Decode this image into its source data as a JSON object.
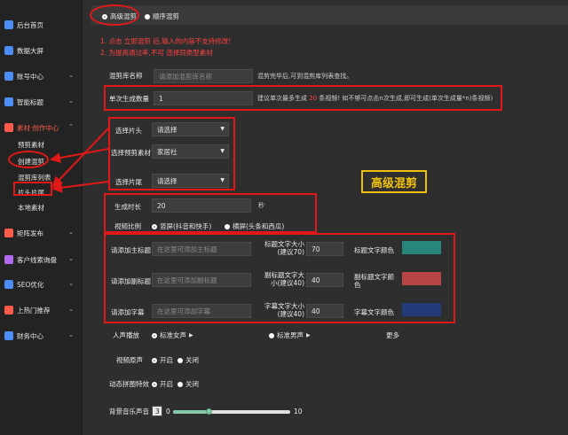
{
  "sidebar": {
    "items": [
      {
        "label": "后台首页",
        "icon": "home-icon",
        "color": "#4c8df6"
      },
      {
        "label": "数据大屏",
        "icon": "dashboard-icon",
        "color": "#4c8df6"
      },
      {
        "label": "账号中心",
        "icon": "account-icon",
        "color": "#4c8df6"
      },
      {
        "label": "智能标题",
        "icon": "title-icon",
        "color": "#4c8df6"
      },
      {
        "label": "素材·创作中心",
        "icon": "material-icon",
        "color": "#ff5a4a"
      },
      {
        "label": "矩阵发布",
        "icon": "publish-icon",
        "color": "#ff5a4a"
      },
      {
        "label": "客户线索询盘",
        "icon": "leads-icon",
        "color": "#b26af0"
      },
      {
        "label": "SEO优化",
        "icon": "seo-icon",
        "color": "#4c8df6"
      },
      {
        "label": "上热门推荐",
        "icon": "hot-icon",
        "color": "#ff5a4a"
      },
      {
        "label": "财务中心",
        "icon": "finance-icon",
        "color": "#4c8df6"
      }
    ],
    "subitems": [
      "预剪素材",
      "创建混剪",
      "混剪库列表",
      "片头片尾",
      "本地素材"
    ]
  },
  "modes": {
    "advanced": "高级混剪",
    "sequential": "顺序混剪"
  },
  "warnings": [
    "1. 点击 立即混剪 后,输入的内容不支持修改!",
    "2. 为提高通过率,不可 选择同类型素材"
  ],
  "form": {
    "lib_name_label": "混剪库名称",
    "lib_name_placeholder": "请添加混剪库名称",
    "lib_name_hint": "混剪完毕后,可到混剪库列表查找。",
    "count_label": "单次生成数量",
    "count_value": "1",
    "count_hint_a": "建议单次最多生成",
    "count_hint_num": "20",
    "count_hint_b": "条视频! 如不够可点击n次生成,即可生成(单次生成量*n)条视频)",
    "head_label": "选择片头",
    "head_value": "请选择",
    "pre_label": "选择预剪素材",
    "pre_value": "家居社",
    "tail_label": "选择片尾",
    "tail_value": "请选择",
    "duration_label": "生成时长",
    "duration_value": "20",
    "duration_unit": "秒",
    "ratio_label": "视频比例",
    "ratio_vertical": "竖屏(抖音和快手)",
    "ratio_horizontal": "横屏(头条和西瓜)",
    "main_title_label": "请添加主标题",
    "main_title_placeholder": "在这里可添加主标题",
    "main_size_label": "标题文字大小(建议70)",
    "main_size_value": "70",
    "main_color_label": "标题文字颜色",
    "main_color": "#27877a",
    "sub_title_label": "请添加副标题",
    "sub_title_placeholder": "在这里可添加副标题",
    "sub_size_label": "副标题文字大小(建议40)",
    "sub_size_value": "40",
    "sub_color_label": "副标题文字颜色",
    "sub_color": "#b84444",
    "caption_label": "请添加字幕",
    "caption_placeholder": "在这里可添加字幕",
    "caption_size_label": "字幕文字大小(建议40)",
    "caption_size_value": "40",
    "caption_color_label": "字幕文字颜色",
    "caption_color": "#243b7a",
    "voice_label": "人声播放",
    "voice_female": "标准女声",
    "voice_male": "标准男声",
    "voice_more": "更多",
    "orig_label": "视频原声",
    "on": "开启",
    "off": "关闭",
    "dyn_label": "动态拼图特效",
    "music_label": "背景音乐声音",
    "music_value": "3",
    "music_min": "0",
    "music_max": "10",
    "music_level": 0.3
  },
  "annotation": "高级混剪"
}
